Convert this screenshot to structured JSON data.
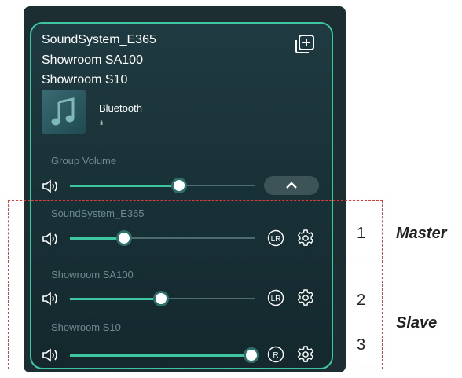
{
  "group": {
    "members": [
      "SoundSystem_E365",
      "Showroom SA100",
      "Showroom S10"
    ],
    "source": "Bluetooth",
    "eq_indicator": "ılı",
    "volume_label": "Group Volume",
    "volume_level": 0.6
  },
  "speakers": [
    {
      "name": "SoundSystem_E365",
      "channel": "LR",
      "volume_level": 0.3
    },
    {
      "name": "Showroom SA100",
      "channel": "LR",
      "volume_level": 0.5
    },
    {
      "name": "Showroom S10",
      "channel": "R",
      "volume_level": 1.0
    }
  ],
  "annotations": {
    "numbers": [
      "1",
      "2",
      "3"
    ],
    "roles": [
      "Master",
      "Slave"
    ]
  },
  "colors": {
    "accent": "#3ec6a0",
    "background": "#1c2e32",
    "annotation": "#e03a3a"
  },
  "icons": [
    "add-group-icon",
    "music-note-icon",
    "speaker-icon",
    "chevron-up-icon",
    "channel-badge-icon",
    "gear-icon"
  ]
}
